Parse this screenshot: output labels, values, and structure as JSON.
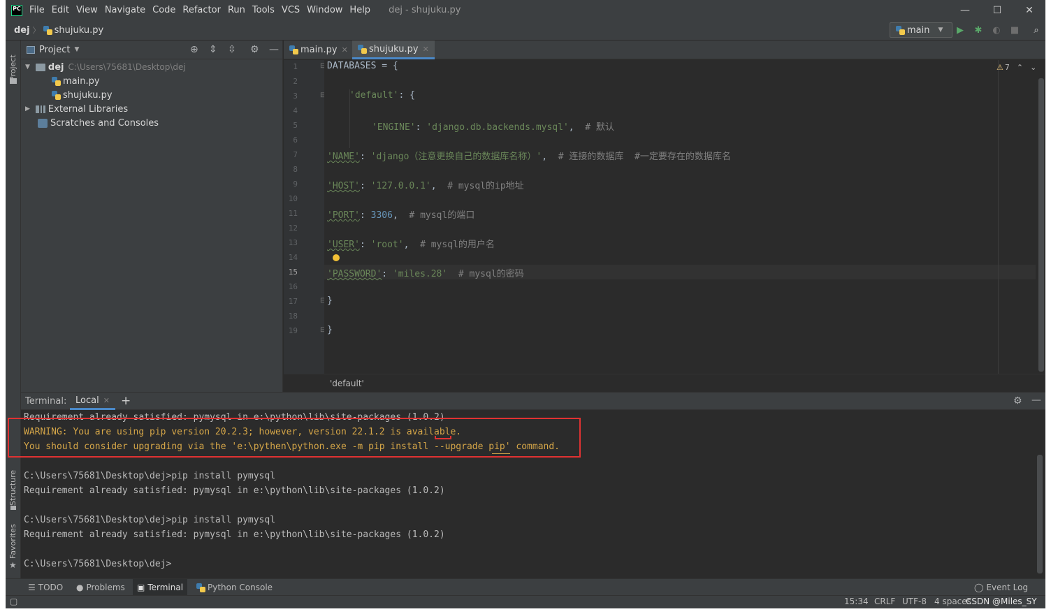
{
  "window": {
    "logo": "PC",
    "menu": [
      "File",
      "Edit",
      "View",
      "Navigate",
      "Code",
      "Refactor",
      "Run",
      "Tools",
      "VCS",
      "Window",
      "Help"
    ],
    "title": "dej - shujuku.py",
    "controls": [
      "—",
      "☐",
      "✕"
    ]
  },
  "navbar": {
    "project": "dej",
    "file": "shujuku.py",
    "run_config": "main"
  },
  "stripe": {
    "project": "Project",
    "structure": "Structure",
    "favorites": "Favorites"
  },
  "project_panel": {
    "title": "Project",
    "root_name": "dej",
    "root_path": "C:\\Users\\75681\\Desktop\\dej",
    "files": [
      "main.py",
      "shujuku.py"
    ],
    "external": "External Libraries",
    "scratches": "Scratches and Consoles"
  },
  "editor": {
    "tabs": [
      {
        "label": "main.py",
        "active": false
      },
      {
        "label": "shujuku.py",
        "active": true
      }
    ],
    "warning_count": "7",
    "current_line": "15",
    "line_numbers": [
      "1",
      "2",
      "3",
      "4",
      "5",
      "6",
      "7",
      "8",
      "9",
      "10",
      "11",
      "12",
      "13",
      "14",
      "15",
      "16",
      "17",
      "18",
      "19"
    ],
    "lines": {
      "l1": "DATABASES = {",
      "l3_key": "'default'",
      "l3_rest": ": {",
      "l5_key": "'ENGINE'",
      "l5_sep": ": ",
      "l5_val": "'django.db.backends.mysql'",
      "l5_comma": ",  ",
      "l5_cmt": "# 默认",
      "l7_key": "'NAME'",
      "l7_sep": ": ",
      "l7_val": "'django（注意更换自己的数据库名称）'",
      "l7_comma": ",  ",
      "l7_cmt": "# 连接的数据库  #一定要存在的数据库名",
      "l9_key": "'HOST'",
      "l9_sep": ": ",
      "l9_val": "'127.0.0.1'",
      "l9_comma": ",  ",
      "l9_cmt": "# mysql的ip地址",
      "l11_key": "'PORT'",
      "l11_sep": ": ",
      "l11_val": "3306",
      "l11_comma": ",  ",
      "l11_cmt": "# mysql的端口",
      "l13_key": "'USER'",
      "l13_sep": ": ",
      "l13_val": "'root'",
      "l13_comma": ",  ",
      "l13_cmt": "# mysql的用户名",
      "l15_key": "'PASSWORD'",
      "l15_sep": ": ",
      "l15_val": "'miles.28'",
      "l15_gap": "  ",
      "l15_cmt": "# mysql的密码",
      "l17": "}",
      "l19": "}"
    },
    "breadcrumb": "'default'"
  },
  "terminal": {
    "label": "Terminal:",
    "tab": "Local",
    "lines": [
      "Requirement already satisfied: pymysql in e:\\python\\lib\\site-packages (1.0.2)",
      "WARNING: You are using pip version 20.2.3; however, version 22.1.2 is available.",
      "You should consider upgrading via the 'e:\\pythen\\python.exe -m pip install --upgrade pip' command.",
      "",
      "C:\\Users\\75681\\Desktop\\dej>pip install pymysql",
      "Requirement already satisfied: pymysql in e:\\python\\lib\\site-packages (1.0.2)",
      "",
      "C:\\Users\\75681\\Desktop\\dej>pip install pymysql",
      "Requirement already satisfied: pymysql in e:\\python\\lib\\site-packages (1.0.2)",
      "",
      "C:\\Users\\75681\\Desktop\\dej>"
    ]
  },
  "bottom_tools": [
    "TODO",
    "Problems",
    "Terminal",
    "Python Console"
  ],
  "event_log": "Event Log",
  "status": {
    "position": "15:34",
    "line_sep": "CRLF",
    "encoding": "UTF-8",
    "indent": "4 spaces",
    "watermark": "CSDN @Miles_SY"
  },
  "colors": {
    "warn": "#d5a648",
    "accent": "#4a88c7",
    "annotation": "#e03232"
  }
}
